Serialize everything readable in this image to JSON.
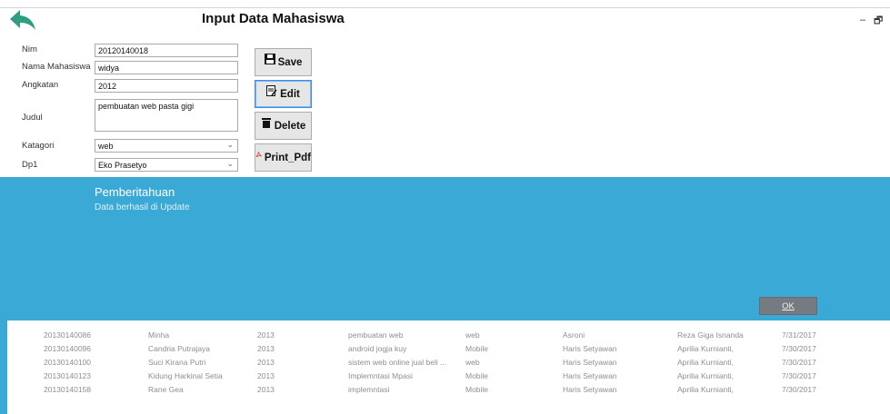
{
  "window": {
    "title": "Input Data Mahasiswa",
    "minimize_glyph": "–",
    "restore_glyph": "🗗"
  },
  "form": {
    "nim": {
      "label": "Nim",
      "value": "20120140018"
    },
    "nama": {
      "label": "Nama Mahasiswa",
      "value": "widya"
    },
    "angkatan": {
      "label": "Angkatan",
      "value": "2012"
    },
    "judul": {
      "label": "Judul",
      "value": "pembuatan web pasta gigi"
    },
    "kategori": {
      "label": "Katagori",
      "value": "web"
    },
    "dp1": {
      "label": "Dp1",
      "value": "Eko Prasetyo"
    }
  },
  "buttons": {
    "save": "Save",
    "edit": "Edit",
    "delete": "Delete",
    "print": "Print_Pdf"
  },
  "notification": {
    "title": "Pemberitahuan",
    "message": "Data berhasil di Update",
    "ok": "OK"
  },
  "table": {
    "rows": [
      [
        "20130140086",
        "Minha",
        "2013",
        "pembuatan web",
        "web",
        "Asroni",
        "Reza Giga Isnanda",
        "7/31/2017"
      ],
      [
        "20130140096",
        "Candria Putrajaya",
        "2013",
        "android jogja kuy",
        "Mobile",
        "Haris Setyawan",
        "Aprilia Kurnianti,",
        "7/30/2017"
      ],
      [
        "20130140100",
        "Suci Kirana Putri",
        "2013",
        "sistem web online jual beli ...",
        "web",
        "Haris Setyawan",
        "Aprilia Kurnianti,",
        "7/30/2017"
      ],
      [
        "20130140123",
        "Kidung Harkinal Setia",
        "2013",
        "Implemntasi Mpasi",
        "Mobile",
        "Haris Setyawan",
        "Aprilia Kurnianti,",
        "7/30/2017"
      ],
      [
        "20130140158",
        "Rane Gea",
        "2013",
        "implemntasi",
        "Mobile",
        "Haris Setyawan",
        "Aprilia Kurnianti,",
        "7/30/2017"
      ]
    ]
  },
  "colors": {
    "accent": "#3aa9d5",
    "back_arrow": "#2e9e82",
    "ok_button": "#757b80"
  }
}
